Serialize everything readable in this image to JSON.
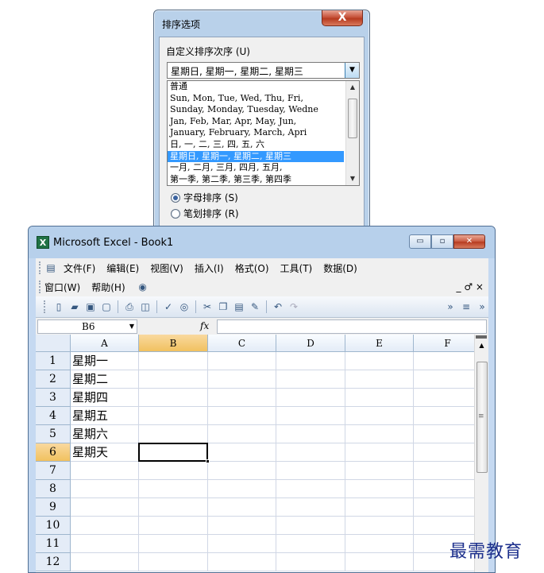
{
  "dialog": {
    "title": "排序选项",
    "close_label": "X",
    "custom_order_label": "自定义排序次序 (U)",
    "combo_value": "星期日, 星期一, 星期二, 星期三",
    "combo_arrow": "▼",
    "list": [
      "普通",
      "Sun, Mon, Tue, Wed, Thu, Fri,",
      "Sunday, Monday, Tuesday, Wedne",
      "Jan, Feb, Mar, Apr, May, Jun,",
      "January, February, March, Apri",
      "日, 一, 二, 三, 四, 五, 六",
      "星期日, 星期一, 星期二, 星期三",
      "一月, 二月, 三月, 四月, 五月,",
      "第一季, 第二季, 第三季, 第四季"
    ],
    "selected_index": 6,
    "list_scroll_up": "▲",
    "list_scroll_down": "▼",
    "radio_alpha": "字母排序 (S)",
    "radio_stroke": "笔划排序 (R)"
  },
  "excel": {
    "logo": "X",
    "title": "Microsoft Excel - Book1",
    "win_min": "▭",
    "win_max": "▫",
    "win_close": "✕",
    "menu_row1": [
      "文件(F)",
      "编辑(E)",
      "视图(V)",
      "插入(I)",
      "格式(O)",
      "工具(T)",
      "数据(D)"
    ],
    "menu_row2": [
      "窗口(W)",
      "帮助(H)"
    ],
    "menu_right": "_ ♂ ×",
    "name_box": "B6",
    "fx": "fx",
    "columns": [
      "A",
      "B",
      "C",
      "D",
      "E",
      "F"
    ],
    "rows": [
      "1",
      "2",
      "3",
      "4",
      "5",
      "6",
      "7",
      "8",
      "9",
      "10",
      "11",
      "12"
    ],
    "cells_A": [
      "星期一",
      "星期二",
      "星期四",
      "星期五",
      "星期六",
      "星期天",
      "",
      "",
      "",
      "",
      "",
      ""
    ],
    "active_cell": "B6",
    "scroll_up": "▲",
    "scroll_grip": "≡"
  },
  "watermark": "最需教育",
  "colors": {
    "selection": "#3399ff",
    "header_active": "#f1c15f",
    "titlebar": "#b7d0eb"
  }
}
